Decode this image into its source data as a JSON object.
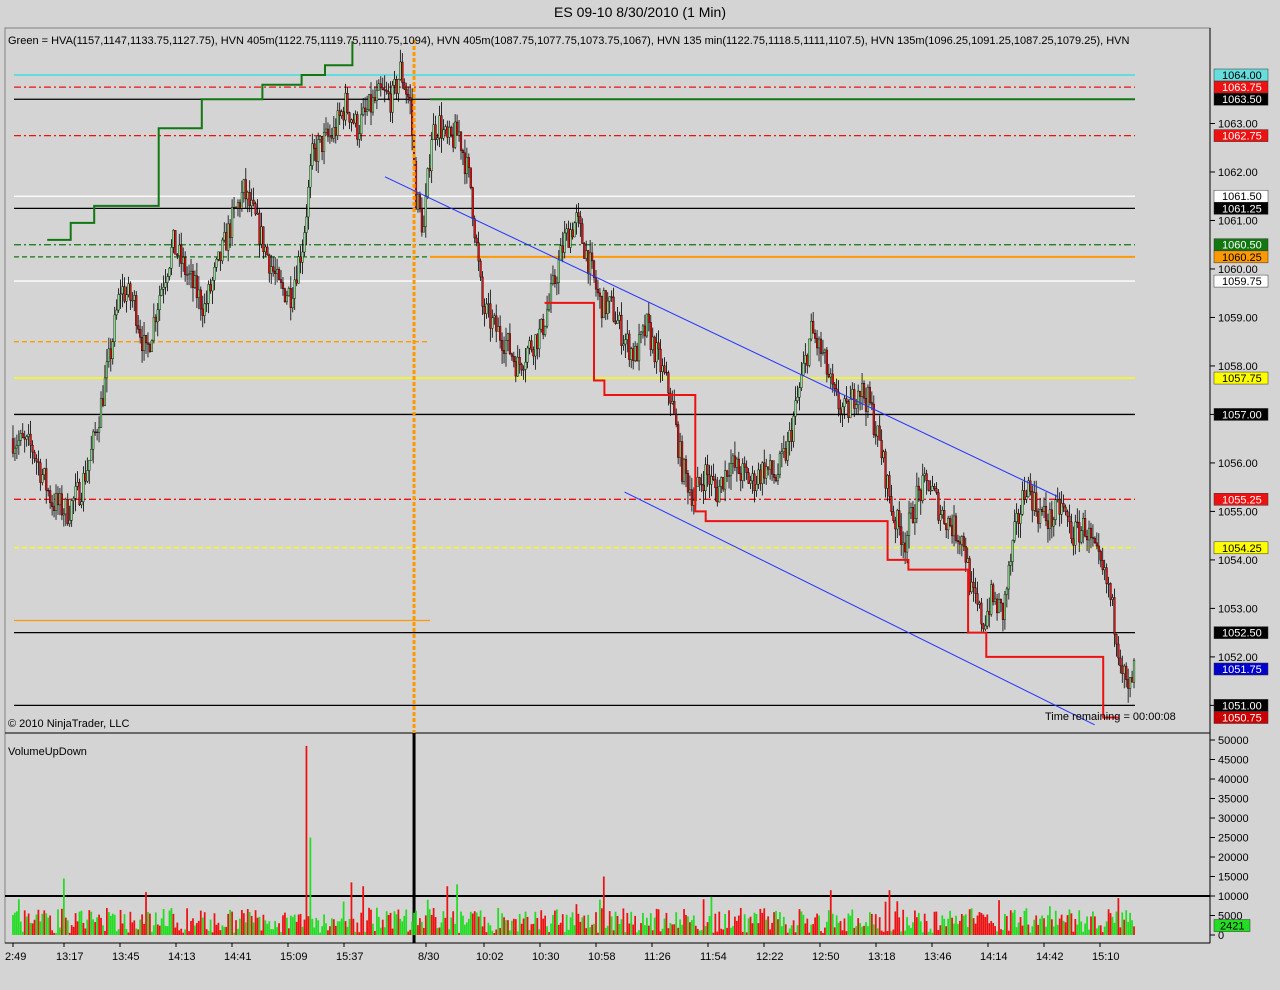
{
  "window": {
    "title": "ES 09-10  8/30/2010 (1 Min)",
    "background": "#d4d4d4",
    "copyright": "© 2010 NinjaTrader, LLC",
    "indicator_label": "VolumeUpDown",
    "time_remaining": "Time remaining = 00:00:08"
  },
  "header_note": "Green = HVA(1157,1147,1133.75,1127.75), HVN 405m(1122.75,1119.75,1110.75,1094), HVN 405m(1087.75,1077.75,1073.75,1067), HVN 135 min(1122.75,1118.5,1111,1107.5), HVN 135m(1096.25,1091.25,1087.25,1079.25), HVN",
  "colors": {
    "up_candle": "#8fe08f",
    "down_candle": "#e01010",
    "volume_up": "#22dd22",
    "volume_down": "#ee1111",
    "channel": "#2233ff",
    "stop_line": "#ee1111",
    "va_line": "#117711",
    "orange": "#ff9900",
    "cyan": "#66dddd",
    "yellow": "#ffff00"
  },
  "chart_data": [
    {
      "type": "candlestick",
      "title": "ES 09-10  8/30/2010 (1 Min)",
      "ylim": [
        1050.5,
        1065.0
      ],
      "y_ticks": [
        "1063.00",
        "1062.00",
        "1061.00",
        "1060.00",
        "1059.00",
        "1058.00",
        "1057.00",
        "1056.00",
        "1055.00",
        "1054.00",
        "1053.00",
        "1052.00",
        "1051.00"
      ],
      "x_labels": [
        "2:49",
        "13:17",
        "13:45",
        "14:13",
        "14:41",
        "15:09",
        "15:37",
        "8/30",
        "10:02",
        "10:30",
        "10:58",
        "11:26",
        "11:54",
        "12:22",
        "12:50",
        "13:18",
        "13:46",
        "14:14",
        "14:42",
        "15:10"
      ],
      "price_path": [
        [
          0,
          1056.5
        ],
        [
          10,
          1056.3
        ],
        [
          20,
          1055.2
        ],
        [
          28,
          1055.0
        ],
        [
          35,
          1055.5
        ],
        [
          40,
          1056.2
        ],
        [
          45,
          1057.2
        ],
        [
          50,
          1058.3
        ],
        [
          55,
          1059.6
        ],
        [
          62,
          1059.3
        ],
        [
          68,
          1058.2
        ],
        [
          75,
          1059.5
        ],
        [
          82,
          1060.5
        ],
        [
          90,
          1059.8
        ],
        [
          98,
          1059.2
        ],
        [
          105,
          1060.1
        ],
        [
          112,
          1061.0
        ],
        [
          118,
          1061.6
        ],
        [
          124,
          1061.0
        ],
        [
          130,
          1060.3
        ],
        [
          136,
          1059.6
        ],
        [
          142,
          1059.5
        ],
        [
          148,
          1060.5
        ],
        [
          153,
          1062.3
        ],
        [
          158,
          1062.6
        ],
        [
          164,
          1062.8
        ],
        [
          170,
          1063.4
        ],
        [
          176,
          1062.9
        ],
        [
          182,
          1063.3
        ],
        [
          188,
          1063.6
        ],
        [
          194,
          1063.5
        ],
        [
          198,
          1064.1
        ],
        [
          203,
          1063.4
        ],
        [
          206,
          1061.5
        ],
        [
          210,
          1060.8
        ],
        [
          214,
          1062.8
        ],
        [
          218,
          1063.0
        ],
        [
          222,
          1062.6
        ],
        [
          228,
          1062.8
        ],
        [
          234,
          1061.7
        ],
        [
          240,
          1059.2
        ],
        [
          246,
          1058.8
        ],
        [
          252,
          1058.5
        ],
        [
          258,
          1058.0
        ],
        [
          264,
          1058.4
        ],
        [
          270,
          1058.7
        ],
        [
          276,
          1059.6
        ],
        [
          282,
          1060.6
        ],
        [
          288,
          1061.0
        ],
        [
          294,
          1060.2
        ],
        [
          300,
          1059.3
        ],
        [
          306,
          1059.2
        ],
        [
          312,
          1058.6
        ],
        [
          318,
          1058.2
        ],
        [
          324,
          1058.8
        ],
        [
          330,
          1058.1
        ],
        [
          336,
          1057.4
        ],
        [
          342,
          1055.9
        ],
        [
          348,
          1055.3
        ],
        [
          354,
          1055.8
        ],
        [
          360,
          1055.4
        ],
        [
          366,
          1056.0
        ],
        [
          372,
          1055.8
        ],
        [
          378,
          1055.6
        ],
        [
          384,
          1055.9
        ],
        [
          390,
          1055.7
        ],
        [
          396,
          1056.3
        ],
        [
          402,
          1057.5
        ],
        [
          408,
          1058.7
        ],
        [
          414,
          1058.2
        ],
        [
          420,
          1057.3
        ],
        [
          426,
          1057.0
        ],
        [
          432,
          1057.6
        ],
        [
          438,
          1057.2
        ],
        [
          444,
          1056.2
        ],
        [
          450,
          1054.9
        ],
        [
          456,
          1054.4
        ],
        [
          462,
          1055.3
        ],
        [
          468,
          1055.6
        ],
        [
          474,
          1055.0
        ],
        [
          480,
          1054.7
        ],
        [
          486,
          1054.4
        ],
        [
          490,
          1053.3
        ],
        [
          496,
          1052.7
        ],
        [
          500,
          1053.2
        ],
        [
          506,
          1052.9
        ],
        [
          512,
          1054.5
        ],
        [
          518,
          1055.6
        ],
        [
          524,
          1055.0
        ],
        [
          530,
          1054.8
        ],
        [
          536,
          1055.1
        ],
        [
          542,
          1054.5
        ],
        [
          548,
          1054.7
        ],
        [
          554,
          1054.0
        ],
        [
          560,
          1053.4
        ],
        [
          564,
          1052.5
        ],
        [
          568,
          1051.6
        ],
        [
          570,
          1051.2
        ],
        [
          573,
          1051.7
        ]
      ],
      "levels": [
        {
          "price": 1064.0,
          "tag": "1064.00",
          "color": "#66dddd",
          "style": "solid",
          "badge_bg": "#66dddd",
          "badge_fg": "#000000",
          "extent": "full"
        },
        {
          "price": 1063.75,
          "tag": "1063.75",
          "color": "#ee1111",
          "style": "dashdot",
          "badge_bg": "#ee1111",
          "badge_fg": "#ffffff",
          "extent": "full"
        },
        {
          "price": 1063.5,
          "tag": "1063.50",
          "color": "#000000",
          "style": "solid",
          "badge_bg": "#000000",
          "badge_fg": "#ffffff",
          "extent": "full"
        },
        {
          "price": 1063.5,
          "tag": "",
          "color": "#117711",
          "style": "solid",
          "badge_bg": "",
          "badge_fg": "",
          "extent": "right"
        },
        {
          "price": 1062.75,
          "tag": "1062.75",
          "color": "#ee1111",
          "style": "dashdot",
          "badge_bg": "#ee1111",
          "badge_fg": "#ffffff",
          "extent": "full"
        },
        {
          "price": 1061.5,
          "tag": "1061.50",
          "color": "#ffffff",
          "style": "solid",
          "badge_bg": "#ffffff",
          "badge_fg": "#000000",
          "extent": "full"
        },
        {
          "price": 1061.25,
          "tag": "1061.25",
          "color": "#000000",
          "style": "solid",
          "badge_bg": "#000000",
          "badge_fg": "#ffffff",
          "extent": "full"
        },
        {
          "price": 1060.5,
          "tag": "1060.50",
          "color": "#117711",
          "style": "dashdot",
          "badge_bg": "#117711",
          "badge_fg": "#ffffff",
          "extent": "full"
        },
        {
          "price": 1060.25,
          "tag": "1060.25",
          "color": "#117711",
          "style": "dashed",
          "badge_bg": "#ff9900",
          "badge_fg": "#000000",
          "extent": "full"
        },
        {
          "price": 1060.25,
          "tag": "",
          "color": "#ff9900",
          "style": "solid",
          "badge_bg": "",
          "badge_fg": "",
          "extent": "right"
        },
        {
          "price": 1059.75,
          "tag": "1059.75",
          "color": "#ffffff",
          "style": "solid",
          "badge_bg": "#ffffff",
          "badge_fg": "#000000",
          "extent": "full"
        },
        {
          "price": 1058.5,
          "tag": "",
          "color": "#ff9900",
          "style": "dashed",
          "badge_bg": "",
          "badge_fg": "",
          "extent": "left"
        },
        {
          "price": 1057.75,
          "tag": "1057.75",
          "color": "#ffff00",
          "style": "solid",
          "badge_bg": "#ffff00",
          "badge_fg": "#000000",
          "extent": "full"
        },
        {
          "price": 1057.0,
          "tag": "1057.00",
          "color": "#000000",
          "style": "solid",
          "badge_bg": "#000000",
          "badge_fg": "#ffffff",
          "extent": "full"
        },
        {
          "price": 1055.25,
          "tag": "1055.25",
          "color": "#ee1111",
          "style": "dashdot",
          "badge_bg": "#ee1111",
          "badge_fg": "#ffffff",
          "extent": "full"
        },
        {
          "price": 1054.25,
          "tag": "1054.25",
          "color": "#ffff00",
          "style": "dashed",
          "badge_bg": "#ffff00",
          "badge_fg": "#000000",
          "extent": "full"
        },
        {
          "price": 1052.75,
          "tag": "",
          "color": "#ff9900",
          "style": "solid",
          "badge_bg": "",
          "badge_fg": "",
          "extent": "left"
        },
        {
          "price": 1052.5,
          "tag": "1052.50",
          "color": "#000000",
          "style": "solid",
          "badge_bg": "#000000",
          "badge_fg": "#ffffff",
          "extent": "full"
        },
        {
          "price": 1051.0,
          "tag": "1051.00",
          "color": "#000000",
          "style": "solid",
          "badge_bg": "#000000",
          "badge_fg": "#ffffff",
          "extent": "full"
        }
      ],
      "current_price_tag": {
        "price": 1051.75,
        "tag": "1051.75",
        "badge_bg": "#0000cc",
        "badge_fg": "#ffffff"
      },
      "low_tag": {
        "price": 1050.75,
        "tag": "1050.75",
        "badge_bg": "#cc0000",
        "badge_fg": "#ffffff"
      },
      "channel_upper": [
        [
          123,
          1061.9
        ],
        [
          345,
          1055.3
        ]
      ],
      "channel_lower": [
        [
          202,
          1055.4
        ],
        [
          357,
          1050.6
        ]
      ],
      "stop_line_steps": [
        [
          205,
          1059.3
        ],
        [
          224,
          1059.3
        ],
        [
          224,
          1057.7
        ],
        [
          228,
          1057.7
        ],
        [
          228,
          1057.4
        ],
        [
          263,
          1057.4
        ],
        [
          263,
          1055.0
        ],
        [
          267,
          1055.0
        ],
        [
          267,
          1054.8
        ],
        [
          337,
          1054.8
        ],
        [
          337,
          1054.0
        ],
        [
          345,
          1054.0
        ],
        [
          345,
          1053.8
        ],
        [
          368,
          1053.8
        ],
        [
          368,
          1052.5
        ],
        [
          375,
          1052.5
        ],
        [
          375,
          1052.0
        ],
        [
          420,
          1052.0
        ],
        [
          420,
          1050.75
        ],
        [
          426,
          1050.75
        ]
      ],
      "va_steps": [
        [
          18,
          1060.6
        ],
        [
          30,
          1060.6
        ],
        [
          30,
          1060.95
        ],
        [
          42,
          1060.95
        ],
        [
          42,
          1061.3
        ],
        [
          75,
          1061.3
        ],
        [
          75,
          1062.9
        ],
        [
          97,
          1062.9
        ],
        [
          97,
          1063.5
        ],
        [
          128,
          1063.5
        ],
        [
          128,
          1063.8
        ],
        [
          148,
          1063.8
        ],
        [
          148,
          1064.0
        ],
        [
          160,
          1064.0
        ],
        [
          160,
          1064.2
        ],
        [
          174,
          1064.2
        ],
        [
          174,
          1064.7
        ]
      ]
    },
    {
      "type": "bar",
      "title": "VolumeUpDown",
      "ylim": [
        0,
        50000
      ],
      "y_ticks": [
        "50000",
        "45000",
        "40000",
        "35000",
        "30000",
        "25000",
        "20000",
        "15000",
        "10000",
        "5000",
        "0"
      ],
      "reference_line": 10000,
      "spikes": [
        {
          "bar": 26,
          "value": 14500,
          "dir": "up"
        },
        {
          "bar": 68,
          "value": 11000,
          "dir": "down"
        },
        {
          "bar": 150,
          "value": 48500,
          "dir": "down"
        },
        {
          "bar": 152,
          "value": 25000,
          "dir": "up"
        },
        {
          "bar": 173,
          "value": 13500,
          "dir": "down"
        },
        {
          "bar": 179,
          "value": 12500,
          "dir": "down"
        },
        {
          "bar": 222,
          "value": 12500,
          "dir": "down"
        },
        {
          "bar": 227,
          "value": 13000,
          "dir": "up"
        },
        {
          "bar": 302,
          "value": 15000,
          "dir": "down"
        },
        {
          "bar": 418,
          "value": 11500,
          "dir": "down"
        },
        {
          "bar": 448,
          "value": 11500,
          "dir": "down"
        }
      ],
      "current_volume_tag": {
        "tag": "2421",
        "badge_bg": "#22dd22",
        "badge_fg": "#000000"
      }
    }
  ],
  "session_divider_label": "8/30"
}
